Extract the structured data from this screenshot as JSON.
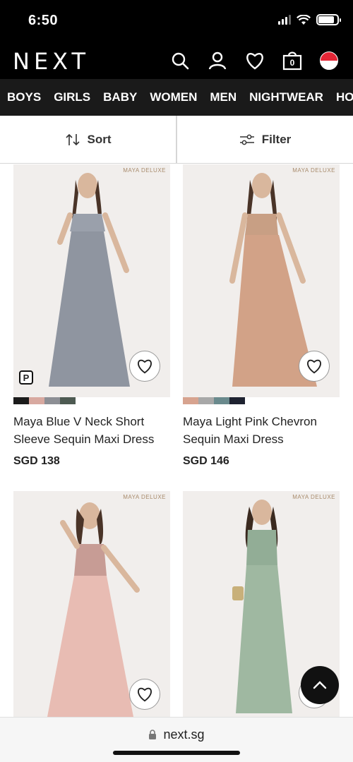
{
  "status": {
    "time": "6:50"
  },
  "header": {
    "logo": "NEXT",
    "icons": [
      "search-icon",
      "account-icon",
      "heart-icon",
      "bag-icon",
      "singapore-flag-icon"
    ],
    "bag_count": "0"
  },
  "categories": [
    "BOYS",
    "GIRLS",
    "BABY",
    "WOMEN",
    "MEN",
    "NIGHTWEAR",
    "HO"
  ],
  "toolbar": {
    "sort_label": "Sort",
    "filter_label": "Filter"
  },
  "products": [
    {
      "brand": "MAYA DELUXE",
      "title_line1": "Maya Blue V Neck Short",
      "title_line2": "Sleeve Sequin Maxi Dress",
      "price": "SGD 138",
      "swatches": [
        "#1b1b1b",
        "#d8a9a0",
        "#8d8f95",
        "#4d5a52"
      ],
      "dress_color": "#8f95a0",
      "bodice_color": "#9aa0ab",
      "badge": "P"
    },
    {
      "brand": "MAYA DELUXE",
      "title_line1": "Maya Light Pink Chevron",
      "title_line2": "Sequin Maxi Dress",
      "price": "SGD 146",
      "swatches": [
        "#d7a38f",
        "#a8a8a8",
        "#6a8a8d",
        "#1e2230"
      ],
      "dress_color": "#d2a287",
      "bodice_color": "#c89f84"
    },
    {
      "brand": "MAYA DELUXE",
      "dress_color": "#e8bcb3",
      "bodice_color": "#c79c95"
    },
    {
      "brand": "MAYA DELUXE",
      "dress_color": "#9fb8a1",
      "bodice_color": "#92ad96"
    }
  ],
  "browser": {
    "url": "next.sg"
  },
  "colors": {
    "nav_bg": "#000000",
    "category_bg": "#1a1a1a",
    "brand_text": "#a88b6c"
  }
}
